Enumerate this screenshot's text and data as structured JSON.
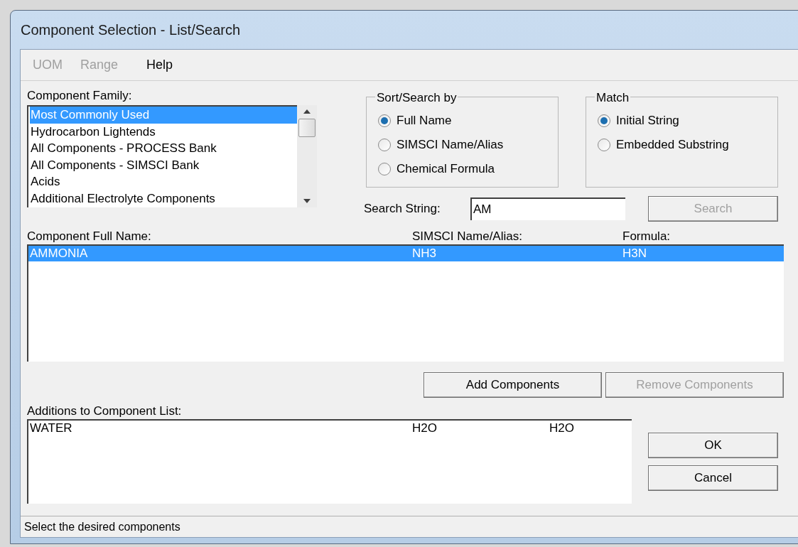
{
  "window": {
    "title": "Component Selection - List/Search"
  },
  "menu": [
    {
      "label": "UOM",
      "disabled": true
    },
    {
      "label": "Range",
      "disabled": true
    },
    {
      "label": "Help",
      "disabled": false
    }
  ],
  "component_family": {
    "label": "Component Family:",
    "items": [
      {
        "label": "Most Commonly Used",
        "selected": true
      },
      {
        "label": "Hydrocarbon Lightends",
        "selected": false
      },
      {
        "label": "All Components - PROCESS Bank",
        "selected": false
      },
      {
        "label": "All Components - SIMSCI Bank",
        "selected": false
      },
      {
        "label": "Acids",
        "selected": false
      },
      {
        "label": "Additional Electrolyte Components",
        "selected": false
      }
    ]
  },
  "sort_search_by": {
    "title": "Sort/Search by",
    "options": [
      {
        "label": "Full Name",
        "selected": true
      },
      {
        "label": "SIMSCI Name/Alias",
        "selected": false
      },
      {
        "label": "Chemical Formula",
        "selected": false
      }
    ]
  },
  "match": {
    "title": "Match",
    "options": [
      {
        "label": "Initial String",
        "selected": true
      },
      {
        "label": "Embedded Substring",
        "selected": false
      }
    ]
  },
  "search": {
    "label": "Search String:",
    "value": "AM",
    "button": {
      "label": "Search",
      "disabled": true
    }
  },
  "results": {
    "columns": [
      "Component Full Name:",
      "SIMSCI Name/Alias:",
      "Formula:"
    ],
    "rows": [
      {
        "name": "AMMONIA",
        "alias": "NH3",
        "formula": "H3N",
        "selected": true
      }
    ]
  },
  "actions": [
    {
      "label": "Add Components",
      "disabled": false
    },
    {
      "label": "Remove Components",
      "disabled": true
    }
  ],
  "additions": {
    "label": "Additions to Component List:",
    "rows": [
      {
        "name": "WATER",
        "alias": "H2O",
        "formula": "H2O"
      }
    ]
  },
  "dialog_buttons": [
    {
      "label": "OK",
      "disabled": false
    },
    {
      "label": "Cancel",
      "disabled": false
    }
  ],
  "status_bar": "Select the desired components"
}
